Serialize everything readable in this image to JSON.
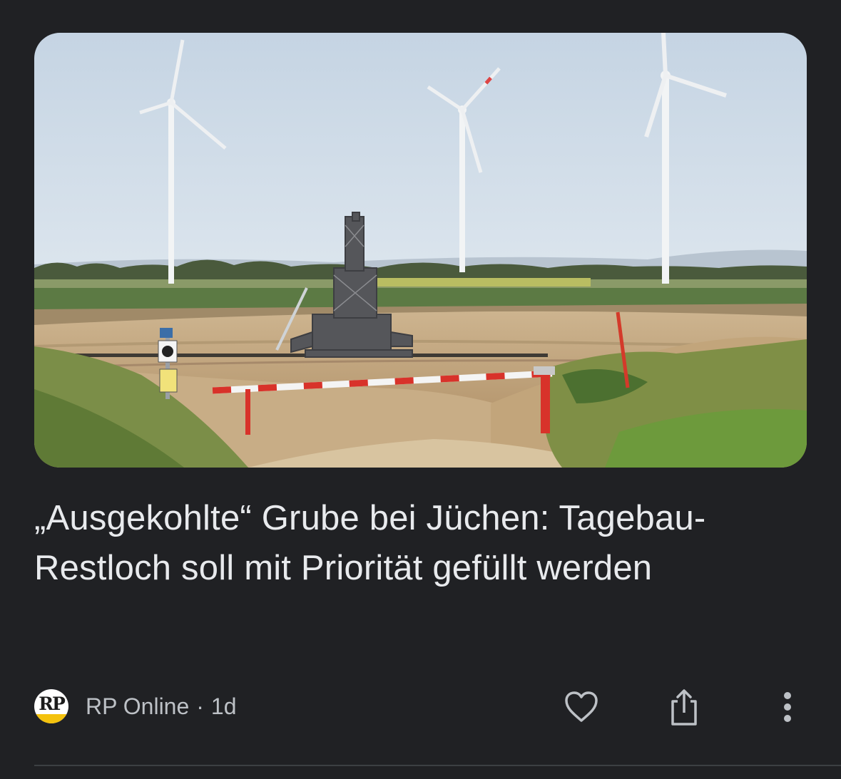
{
  "article": {
    "headline": "„Ausgekohlte“ Grube bei Jüchen: Tagebau-Restloch soll mit Priorität gefüllt werden",
    "source": "RP Online",
    "separator": "·",
    "age": "1d",
    "publisher_logo_text": "RP"
  },
  "actions": [
    {
      "name": "like",
      "icon": "heart-outline-icon"
    },
    {
      "name": "share",
      "icon": "share-icon"
    },
    {
      "name": "more",
      "icon": "more-vert-icon"
    }
  ],
  "colors": {
    "background": "#202124",
    "headline_text": "#e8eaed",
    "meta_text": "#bdc1c6",
    "divider": "#3c4043",
    "logo_accent": "#f4c20d"
  }
}
